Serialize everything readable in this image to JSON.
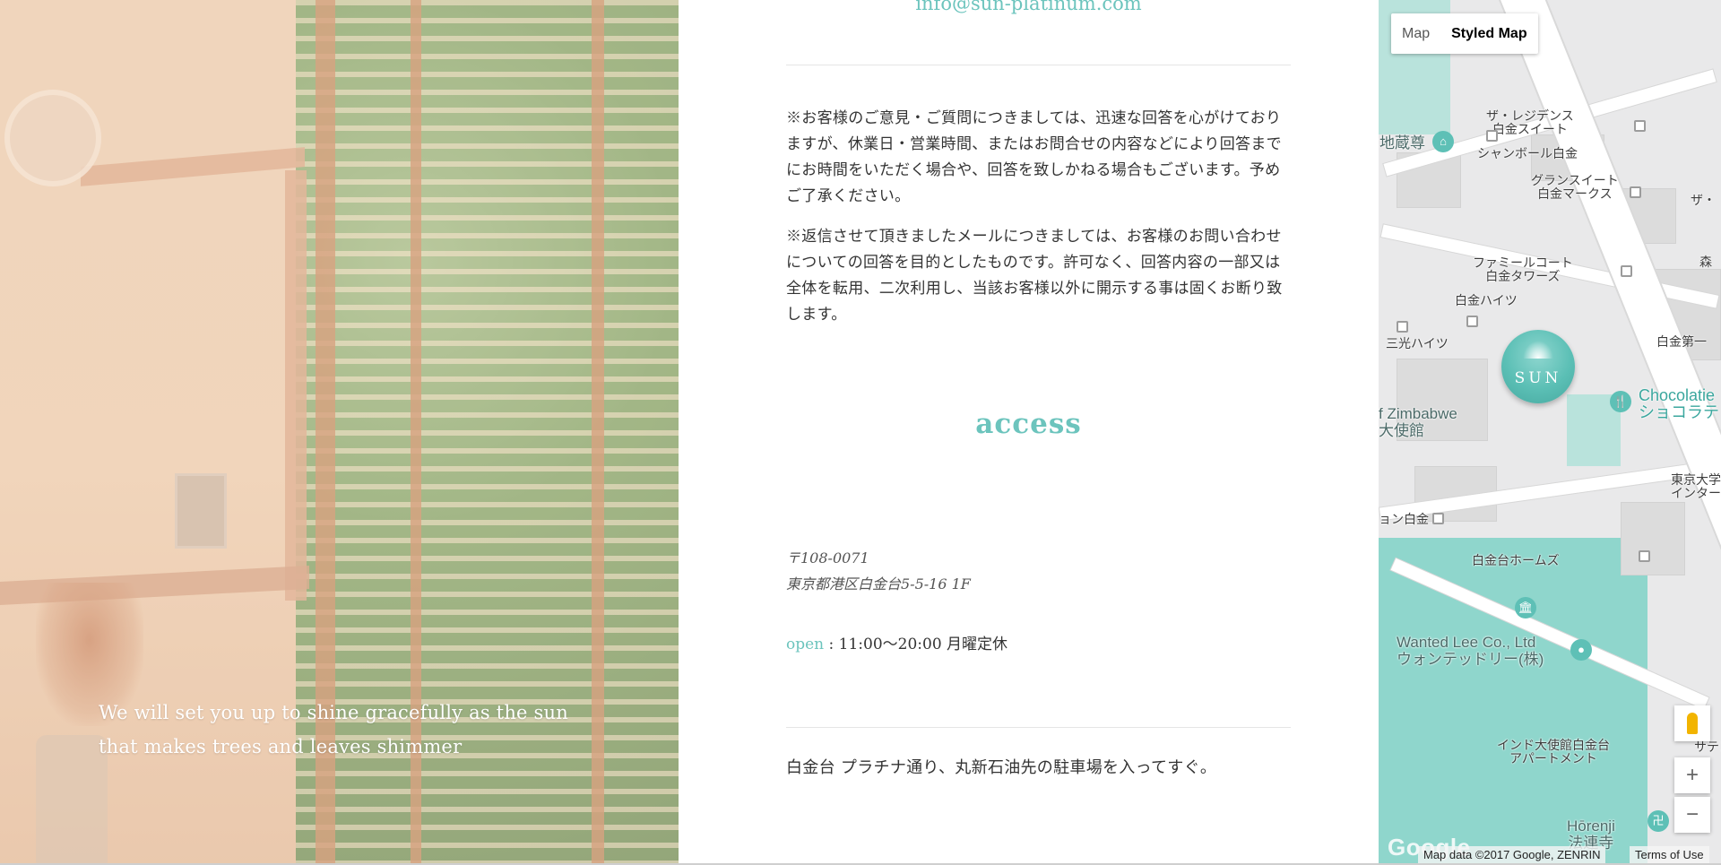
{
  "contact": {
    "email": "info@sun-platinum.com",
    "notice_1": "※お客様のご意見・ご質問につきましては、迅速な回答を心がけておりますが、休業日・営業時間、またはお問合せの内容などにより回答までにお時間をいただく場合や、回答を致しかねる場合もございます。予めご了承ください。",
    "notice_2": "※返信させて頂きましたメールにつきましては、お客様のお問い合わせについての回答を目的としたものです。許可なく、回答内容の一部又は全体を転用、二次利用し、当該お客様以外に開示する事は固くお断り致します。"
  },
  "hero": {
    "tagline_line1": "We will set you up to shine gracefully as the sun",
    "tagline_line2": "that makes trees and leaves shimmer"
  },
  "access": {
    "title": "access",
    "postal": "〒108-0071",
    "address": "東京都港区白金台5-5-16 1F",
    "open_label": "open",
    "hours": " : 11:00〜20:00 月曜定休",
    "direction": "白金台 プラチナ通り、丸新石油先の駐車場を入ってすぐ。"
  },
  "map": {
    "toggle": {
      "map": "Map",
      "styled": "Styled Map"
    },
    "marker_text": "SUN",
    "zoom_in": "+",
    "zoom_out": "−",
    "attribution": "Map data ©2017 Google, ZENRIN",
    "terms": "Terms of Use",
    "logo": "Google",
    "labels": {
      "residence": "ザ・レジデンス\n白金スイート",
      "jizo": "地蔵尊",
      "chambord": "シャンボール白金",
      "grandsuite": "グランスイート\n白金マークス",
      "za": "ザ・",
      "familiar": "ファミールコート\n白金タワーズ",
      "mori": "森",
      "heights": "白金ハイツ",
      "sanko": "三光ハイツ",
      "shirokane1": "白金第一",
      "zimbabwe": "f Zimbabwe\n大使館",
      "chocolatier": "Chocolatie\nショコラテ",
      "tokyo_univ": "東京大学\nインター",
      "shirokane_on": "ョン白金",
      "homes": "白金台ホームズ",
      "wanted": "Wanted Lee Co., Ltd\nウォンテッドリー(株)",
      "india": "インド大使館白金台\nアパートメント",
      "horenji": "Hōrenji\n法連寺",
      "satan": "サテン"
    }
  }
}
